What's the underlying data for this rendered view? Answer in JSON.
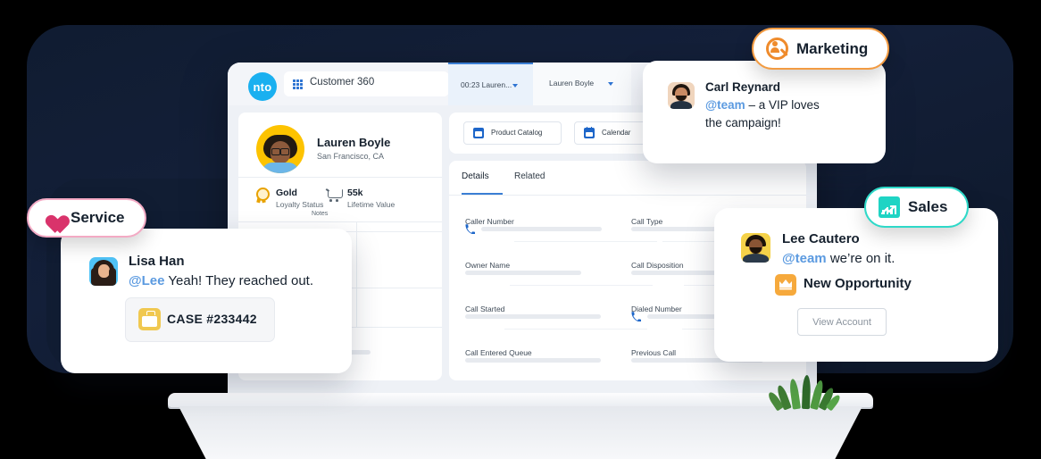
{
  "app": {
    "logo_text": "nto",
    "page_title": "Customer 360",
    "grid_icon": "app-grid-icon",
    "tab_call": "00:23 Lauren...",
    "tab_record": "Lauren Boyle"
  },
  "customer": {
    "name": "Lauren Boyle",
    "location": "San Francisco, CA",
    "loyalty_value": "Gold",
    "loyalty_label": "Loyalty Status",
    "lifetime_value": "55k",
    "lifetime_label": "Lifetime Value",
    "notes_label": "Notes"
  },
  "toolbar": {
    "buttons": [
      {
        "label": "Product Catalog",
        "icon": "catalog-icon"
      },
      {
        "label": "Calendar",
        "icon": "calendar-icon"
      }
    ]
  },
  "content_tabs": [
    {
      "label": "Details",
      "active": true
    },
    {
      "label": "Related",
      "active": false
    }
  ],
  "fields": [
    {
      "label": "Caller Number",
      "icon": "phone-icon"
    },
    {
      "label": "Call Type",
      "icon": null
    },
    {
      "label": "Owner Name",
      "icon": null
    },
    {
      "label": "Call Disposition",
      "icon": null
    },
    {
      "label": "Call Started",
      "icon": null
    },
    {
      "label": "Dialed Number",
      "icon": "phone-icon"
    },
    {
      "label": "Call Entered Queue",
      "icon": null
    },
    {
      "label": "Previous Call",
      "icon": null
    }
  ],
  "badges": {
    "service": {
      "label": "Service",
      "icon": "heart-icon",
      "color": "#d9336b",
      "border": "#f3aac4"
    },
    "marketing": {
      "label": "Marketing",
      "icon": "person-magnifier-icon",
      "color": "#ef8b2c",
      "border": "#f29b42"
    },
    "sales": {
      "label": "Sales",
      "icon": "trend-chart-icon",
      "color": "#1fd4c4",
      "border": "#2ed9c8"
    }
  },
  "cards": {
    "service": {
      "author": "Lisa Han",
      "mention": "@Lee",
      "message": " Yeah! They reached out.",
      "case_label": "CASE #233442",
      "case_icon": "briefcase-icon"
    },
    "marketing": {
      "author": "Carl Reynard",
      "mention": "@team",
      "message_line1": " – a VIP loves",
      "message_line2": "the campaign!"
    },
    "sales": {
      "author": "Lee Cautero",
      "mention": "@team",
      "message": " we’re on it.",
      "opportunity_label": "New Opportunity",
      "opportunity_icon": "crown-icon",
      "button_label": "View Account"
    }
  }
}
